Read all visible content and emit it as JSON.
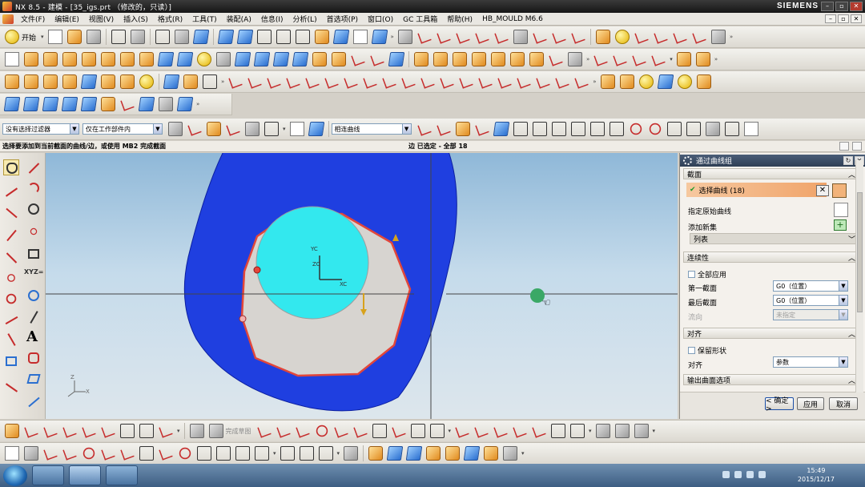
{
  "window": {
    "title": "NX 8.5 - 建模 - [35_igs.prt （修改的，只读）]",
    "brand": "SIEMENS"
  },
  "menu": [
    "文件(F)",
    "编辑(E)",
    "视图(V)",
    "插入(S)",
    "格式(R)",
    "工具(T)",
    "装配(A)",
    "信息(I)",
    "分析(L)",
    "首选项(P)",
    "窗口(O)",
    "GC 工具箱",
    "帮助(H)",
    "HB_MOULD M6.6"
  ],
  "toolbar": {
    "start_label": "开始",
    "finish_sketch": "完成草图"
  },
  "filters": {
    "selection_filter": "没有选择过滤器",
    "scope": "仅在工作部件内",
    "curve_rule": "相连曲线"
  },
  "cue": "选择要添加到当前截面的曲线/边，或使用 MB2 完成截面",
  "status": "边 已选定 - 全部 18",
  "viewport": {
    "axis_labels": {
      "yc": "YC",
      "xc": "XC",
      "zc": "ZC",
      "x": "X",
      "z": "Z"
    }
  },
  "dialog": {
    "title": "通过曲线组",
    "section_header": "截面",
    "select_curve": "选择曲线 (18)",
    "specify_origin": "指定原始曲线",
    "add_new_set": "添加新集",
    "list_label": "列表",
    "continuity_header": "连续性",
    "apply_all": "全部应用",
    "first_section": "第一截面",
    "first_value": "G0（位置）",
    "last_section": "最后截面",
    "last_value": "G0（位置）",
    "flow_label": "流向",
    "flow_value": "未指定",
    "align_header": "对齐",
    "keep_shape": "保留形状",
    "align_label": "对齐",
    "align_value": "参数",
    "output_header": "输出曲面选项",
    "ok_label": "< 确定 >",
    "apply_label": "应用",
    "cancel_label": "取消"
  },
  "taskbar": {
    "time": "15:49",
    "date": "2015/12/17"
  },
  "colors": {
    "surface": "#1f3fe0",
    "circle": "#33e8ee",
    "section_curve": "#e2463a",
    "title_bg": "#1a1a1a",
    "selected_row": "#f2b37a"
  }
}
